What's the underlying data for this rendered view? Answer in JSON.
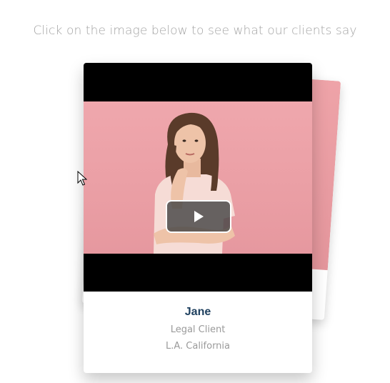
{
  "intro_text": "Click on the image below to see what our clients say",
  "testimonial": {
    "name": "Jane",
    "role": "Legal Client",
    "location": "L.A. California"
  },
  "video": {
    "play_icon": "play-icon"
  },
  "colors": {
    "name_color": "#1d3f5e",
    "photo_background": "#eca3a9",
    "muted_text": "#9a9a9a"
  }
}
